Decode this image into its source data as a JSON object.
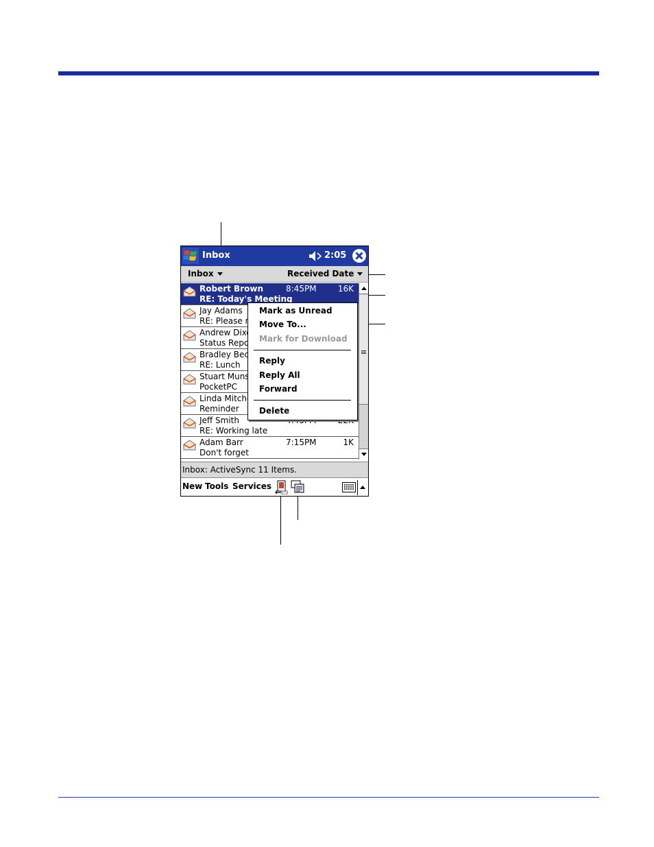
{
  "titlebar": {
    "title": "Inbox",
    "time": "2:05"
  },
  "folderbar": {
    "folder_label": "Inbox",
    "sort_label": "Received Date"
  },
  "messages": [
    {
      "sender": "Robert Brown",
      "subject": "RE: Today's Meeting",
      "time": "8:45PM",
      "size": "16K",
      "selected": true
    },
    {
      "sender": "Jay Adams",
      "subject": "RE: Please re",
      "time": "",
      "size": ""
    },
    {
      "sender": "Andrew Dixo",
      "subject": "Status Repor",
      "time": "",
      "size": ""
    },
    {
      "sender": "Bradley Beck",
      "subject": "RE: Lunch",
      "time": "",
      "size": ""
    },
    {
      "sender": "Stuart Munso",
      "subject": "PocketPC",
      "time": "",
      "size": ""
    },
    {
      "sender": "Linda Mitchel",
      "subject": "Reminder",
      "time": "",
      "size": ""
    },
    {
      "sender": "Jeff Smith",
      "subject": "RE: Working late",
      "time": "4:45PM",
      "size": "22K"
    },
    {
      "sender": "Adam Barr",
      "subject": "Don't forget",
      "time": "7:15PM",
      "size": "1K"
    }
  ],
  "context_menu": {
    "mark_unread": "Mark as Unread",
    "move_to": "Move To...",
    "mark_download": "Mark for Download",
    "reply": "Reply",
    "reply_all": "Reply All",
    "forward": "Forward",
    "delete": "Delete"
  },
  "statusbar": {
    "text": "Inbox: ActiveSync  11 Items."
  },
  "menubar": {
    "new": "New",
    "tools": "Tools",
    "services": "Services"
  },
  "icons": {
    "start": "windows-start-icon",
    "speaker": "speaker-muted-icon",
    "close": "close-icon",
    "envelope": "envelope-open-icon",
    "send_receive": "send-receive-icon",
    "folders": "folder-list-icon",
    "keyboard": "keyboard-icon"
  },
  "colors": {
    "titlebar": "#1f3aa0",
    "selected_row": "#1f2f8a",
    "rule": "#1a2c9c"
  }
}
